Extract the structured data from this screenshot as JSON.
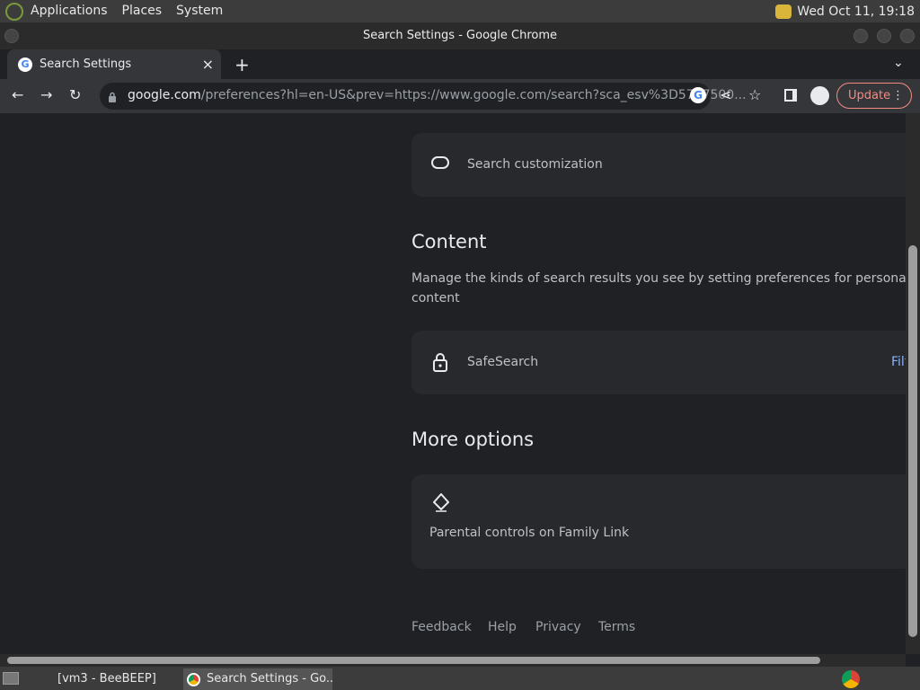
{
  "system_panel": {
    "menus": [
      "Applications",
      "Places",
      "System"
    ],
    "clock": "Wed Oct 11, 19:18"
  },
  "window": {
    "title": "Search Settings - Google Chrome"
  },
  "tab": {
    "title": "Search Settings",
    "new_tab_glyph": "+",
    "close_glyph": "×"
  },
  "toolbar": {
    "url_host": "google.com",
    "url_rest": "/preferences?hl=en-US&prev=https://www.google.com/search?sca_esv%3D5727500...",
    "update_label": "Update"
  },
  "content": {
    "search_customization_label": "Search customization",
    "content_heading": "Content",
    "content_description_line1": "Manage the kinds of search results you see by setting preferences for personalization and",
    "content_description_line2": "content",
    "safesearch_label": "SafeSearch",
    "safesearch_link": "Filt",
    "more_options_heading": "More options",
    "parental_controls_label": "Parental controls on Family Link",
    "footer_links": [
      "Feedback",
      "Help",
      "Privacy",
      "Terms"
    ]
  },
  "taskbar": {
    "tasks": [
      "[vm3 - BeeBEEP]",
      "Search Settings - Go..."
    ]
  },
  "colors": {
    "background": "#202124",
    "card": "#28292c",
    "accent_link": "#8ab4f8",
    "update_border": "#f28b82"
  }
}
